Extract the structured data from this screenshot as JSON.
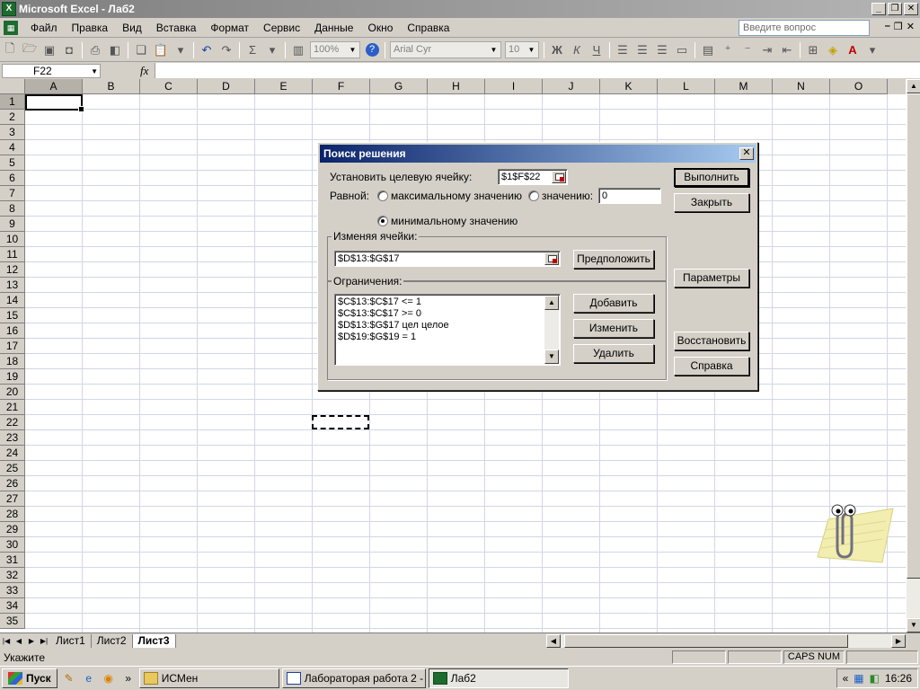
{
  "window": {
    "title": "Microsoft Excel - Лаб2",
    "app_icon": "X"
  },
  "menu": {
    "items": [
      "Файл",
      "Правка",
      "Вид",
      "Вставка",
      "Формат",
      "Сервис",
      "Данные",
      "Окно",
      "Справка"
    ],
    "help_placeholder": "Введите вопрос"
  },
  "toolbar": {
    "zoom": "100%",
    "font_name": "Arial Cyr",
    "font_size": "10",
    "bold": "Ж",
    "italic": "К",
    "underline": "Ч",
    "sum": "Σ"
  },
  "formula_bar": {
    "name_box": "F22",
    "fx": "fx",
    "formula": ""
  },
  "grid": {
    "columns": [
      "A",
      "B",
      "C",
      "D",
      "E",
      "F",
      "G",
      "H",
      "I",
      "J",
      "K",
      "L",
      "M",
      "N",
      "O"
    ],
    "rows": [
      "1",
      "2",
      "3",
      "4",
      "5",
      "6",
      "7",
      "8",
      "9",
      "10",
      "11",
      "12",
      "13",
      "14",
      "15",
      "16",
      "17",
      "18",
      "19",
      "20",
      "21",
      "22",
      "23",
      "24",
      "25",
      "26",
      "27",
      "28",
      "29",
      "30",
      "31",
      "32",
      "33",
      "34",
      "35"
    ],
    "active_column": "A",
    "active_row": "1"
  },
  "sheets": {
    "tabs": [
      "Лист1",
      "Лист2",
      "Лист3"
    ],
    "active": "Лист3"
  },
  "status": {
    "text": "Укажите",
    "caps": "CAPS",
    "num": "NUM"
  },
  "taskbar": {
    "start": "Пуск",
    "tasks": [
      {
        "label": "ИСМен",
        "active": false
      },
      {
        "label": "Лабораторая работа 2 - ...",
        "active": false
      },
      {
        "label": "Лаб2",
        "active": true
      }
    ],
    "clock": "16:26"
  },
  "solver": {
    "title": "Поиск решения",
    "target_label": "Установить целевую ячейку:",
    "target_value": "$1$F$22",
    "equal_label": "Равной:",
    "max_label": "максимальному значению",
    "value_label": "значению:",
    "value_input": "0",
    "min_label": "минимальному значению",
    "selected_option": "min",
    "changing_group": "Изменяя ячейки:",
    "changing_value": "$D$13:$G$17",
    "constraints_group": "Ограничения:",
    "constraints": [
      "$C$13:$C$17 <= 1",
      "$C$13:$C$17 >= 0",
      "$D$13:$G$17 цел целое",
      "$D$19:$G$19 = 1"
    ],
    "buttons": {
      "solve": "Выполнить",
      "close": "Закрыть",
      "guess": "Предположить",
      "options": "Параметры",
      "add": "Добавить",
      "change": "Изменить",
      "delete": "Удалить",
      "reset": "Восстановить",
      "help": "Справка"
    }
  }
}
